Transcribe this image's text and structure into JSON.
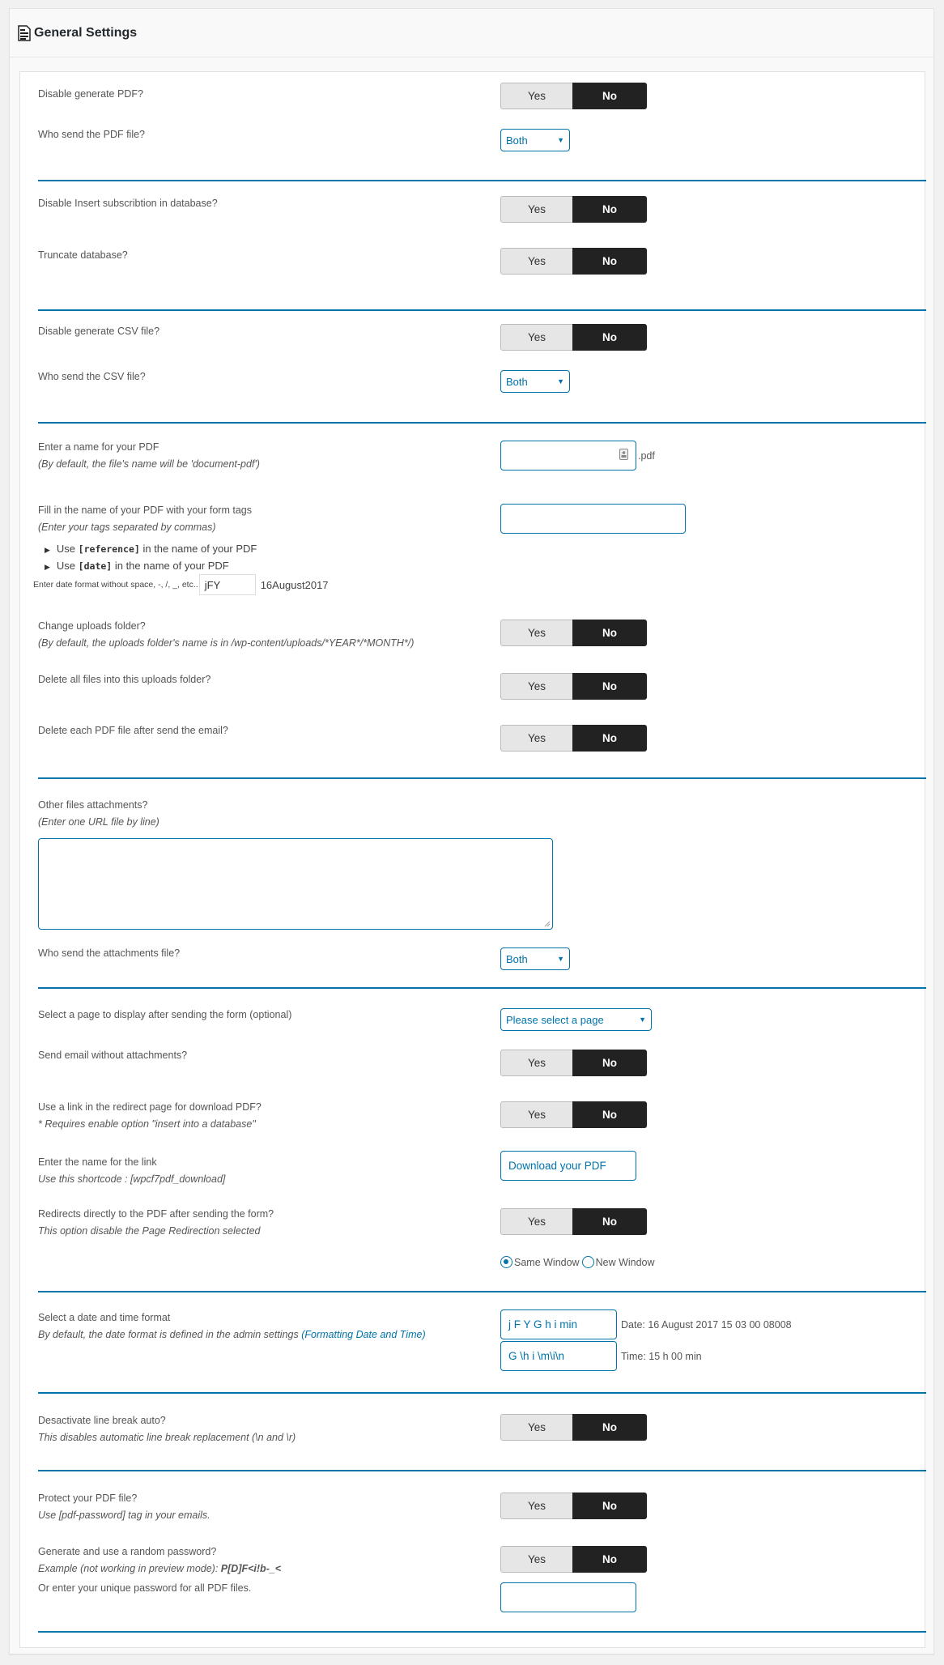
{
  "header": {
    "title": "General Settings",
    "icon": "document-icon"
  },
  "toggle": {
    "yes": "Yes",
    "no": "No",
    "selected": "No"
  },
  "sections": {
    "pdf": {
      "disable_generate_pdf": "Disable generate PDF?",
      "who_send_pdf": "Who send the PDF file?",
      "who_send_pdf_value": "Both"
    },
    "database": {
      "disable_insert": "Disable Insert subscribtion in database?",
      "truncate": "Truncate database?"
    },
    "csv": {
      "disable_generate_csv": "Disable generate CSV file?",
      "who_send_csv": "Who send the CSV file?",
      "who_send_csv_value": "Both"
    },
    "naming": {
      "pdf_name_label": "Enter a name for your PDF",
      "pdf_name_sub": "(By default, the file's name will be 'document-pdf')",
      "pdf_name_value": "",
      "pdf_suffix": ".pdf",
      "tags_label": "Fill in the name of your PDF with your form tags",
      "tags_sub": "(Enter your tags separated by commas)",
      "tags_value": "",
      "use_prefix": "Use",
      "reference_tag": "[reference]",
      "date_tag": "[date]",
      "use_suffix": "in the name of your PDF",
      "date_format_label": "Enter date format without space, -, /, _, etc..",
      "date_format_value": "jFY",
      "date_format_preview": "16August2017",
      "change_uploads": "Change uploads folder?",
      "change_uploads_sub": "(By default, the uploads folder's name is in /wp-content/uploads/*YEAR*/*MONTH*/)",
      "delete_all_files": "Delete all files into this uploads folder?",
      "delete_each_pdf": "Delete each PDF file after send the email?"
    },
    "attachments": {
      "other_files_label": "Other files attachments?",
      "other_files_sub": "(Enter one URL file by line)",
      "other_files_value": "",
      "who_send_attachments": "Who send the attachments file?",
      "who_send_attachments_value": "Both"
    },
    "redirect": {
      "select_page_label": "Select a page to display after sending the form (optional)",
      "select_page_value": "Please select a page",
      "send_without_attachments": "Send email without attachments?",
      "use_link_label": "Use a link in the redirect page for download PDF?",
      "use_link_sub": "* Requires enable option \"insert into a database\"",
      "link_name_label": "Enter the name for the link",
      "link_name_sub": "Use this shortcode : [wpcf7pdf_download]",
      "link_name_value": "Download your PDF",
      "redirect_pdf_label": "Redirects directly to the PDF after sending the form?",
      "redirect_pdf_sub": "This option disable the Page Redirection selected",
      "window_options": [
        {
          "label": "Same Window",
          "checked": true
        },
        {
          "label": "New Window",
          "checked": false
        }
      ]
    },
    "datetime": {
      "label": "Select a date and time format",
      "sub": "By default, the date format is defined in the admin settings",
      "sub_link": "(Formatting Date and Time)",
      "date_format_value": "j F Y G h i min",
      "date_preview": "Date: 16 August 2017 15 03 00 08008",
      "time_format_value": "G \\h i \\m\\i\\n",
      "time_preview": "Time: 15 h 00 min"
    },
    "linebreak": {
      "label": "Desactivate line break auto?",
      "sub": "This disables automatic line break replacement (\\n and \\r)"
    },
    "protect": {
      "protect_label": "Protect your PDF file?",
      "protect_sub": "Use [pdf-password] tag in your emails.",
      "random_label": "Generate and use a random password?",
      "random_sub_prefix": "Example (not working in preview mode): ",
      "random_example": "P[D]F<i!b-_<",
      "unique_label": "Or enter your unique password for all PDF files.",
      "unique_value": ""
    }
  },
  "colors": {
    "accent": "#0073aa",
    "toggle_on": "#222222",
    "toggle_off": "#e6e6e6"
  }
}
